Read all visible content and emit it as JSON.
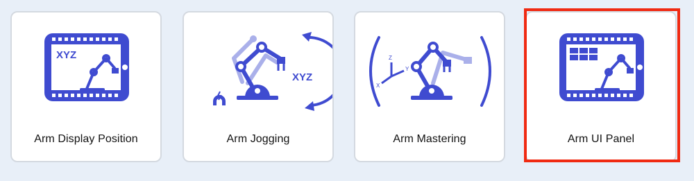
{
  "colors": {
    "background": "#e8eff8",
    "card": "#ffffff",
    "card_border": "#d4d9e0",
    "icon_primary": "#3f4bd0",
    "icon_light": "#aab0ea",
    "highlight": "#f02a12"
  },
  "cards": [
    {
      "label": "Arm Display Position",
      "icon": "tablet-robot-arm-xyz-icon",
      "icon_text": "XYZ"
    },
    {
      "label": "Arm Jogging",
      "icon": "robot-arm-jog-rotate-icon",
      "icon_text": "XYZ"
    },
    {
      "label": "Arm Mastering",
      "icon": "robot-arm-mastering-axes-icon",
      "icon_text": [
        "X",
        "Y",
        "Z"
      ]
    },
    {
      "label": "Arm UI Panel",
      "icon": "tablet-robot-arm-panel-icon",
      "selected": true
    }
  ]
}
